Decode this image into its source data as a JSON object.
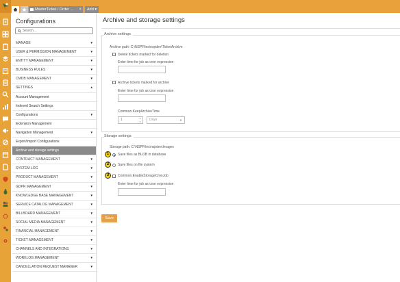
{
  "topbar": {
    "tabs": [
      {
        "label": "MasterTicket / Order ...",
        "close": "×"
      }
    ],
    "add_label": "Add ▾",
    "colors": {
      "bar": "#e9a23b",
      "tab": "#8c8c8c"
    }
  },
  "rail": {
    "icons": [
      "file-icon",
      "grid-icon",
      "clipboard-icon",
      "layers-icon",
      "document-icon",
      "folder-icon",
      "calculator-icon",
      "search-icon",
      "bar-chart-icon",
      "chat-icon",
      "megaphone-icon",
      "ban-icon",
      "calendar-icon",
      "page-icon",
      "shield-icon",
      "bug-icon",
      "people-icon",
      "gear-icon",
      "gears-icon",
      "cog-icon"
    ]
  },
  "config": {
    "title": "Configurations",
    "search_placeholder": "Search...",
    "menu": [
      {
        "label": "MANAGE",
        "arrow": "▼"
      },
      {
        "label": "USER & PERMISSION MANAGEMENT",
        "arrow": "▼"
      },
      {
        "label": "ENTITY MANAGEMENT",
        "arrow": "▼"
      },
      {
        "label": "BUSINESS RULES",
        "arrow": "▼"
      },
      {
        "label": "CMDB MANAGEMENT",
        "arrow": "▼"
      },
      {
        "label": "SETTINGS",
        "arrow": "▲"
      },
      {
        "label": "Account Management",
        "arrow": ""
      },
      {
        "label": "Indexed Search Settings",
        "arrow": ""
      },
      {
        "label": "Configurations",
        "arrow": "▼"
      },
      {
        "label": "Extension Management",
        "arrow": ""
      },
      {
        "label": "Navigation Management",
        "arrow": "▼"
      },
      {
        "label": "Export/Import Configurations",
        "arrow": ""
      },
      {
        "label": "Archive and storage settings",
        "arrow": ""
      },
      {
        "label": "CONTRACT MANAGEMENT",
        "arrow": "▼"
      },
      {
        "label": "SYSTEM LOG",
        "arrow": "▼"
      },
      {
        "label": "PRODUCT MANAGEMENT",
        "arrow": "▼"
      },
      {
        "label": "GDPR MANAGEMENT",
        "arrow": "▼"
      },
      {
        "label": "KNOWLEDGE BASE MANAGEMENT",
        "arrow": "▼"
      },
      {
        "label": "SERVICE CATALOG MANAGEMENT",
        "arrow": "▼"
      },
      {
        "label": "BILLBOARD MANAGEMENT",
        "arrow": "▼"
      },
      {
        "label": "SOCIAL MEDIA MANAGEMENT",
        "arrow": "▼"
      },
      {
        "label": "FINANCIAL MANAGEMENT",
        "arrow": "▼"
      },
      {
        "label": "TICKET MANAGEMENT",
        "arrow": "▼"
      },
      {
        "label": "CHANNELS AND INTEGRATIONS",
        "arrow": "▼"
      },
      {
        "label": "WORKLOG MANAGEMENT",
        "arrow": "▼"
      },
      {
        "label": "CANCELLATION REQUEST MANAGER",
        "arrow": "▼"
      }
    ]
  },
  "page": {
    "title": "Archive and storage settings",
    "archive": {
      "legend": "Archive settings",
      "path_label": "Archive path: C:\\NSPFiles\\nspdev\\TicketArchive",
      "delete_label": "Delete tickets marked for deletion",
      "cron_label_1": "Enter time for job as cron expression",
      "archive_label": "Archive tickets marked for archive",
      "cron_label_2": "Enter time for job as cron expression",
      "keep_label": "Common.KeepArchiveTime",
      "keep_value": "1",
      "keep_unit": "Days"
    },
    "storage": {
      "legend": "Storage settings",
      "path_label": "Storage path: C:\\NSPFiles\\nspdev\\Images",
      "opt_blob": "Save files as BLOB in database",
      "opt_fs": "Save files on file system",
      "opt_cron": "Common.EnableStorageCronJob",
      "cron_label": "Enter time for job as cron expression",
      "badges": [
        "1",
        "2",
        "3"
      ]
    },
    "save_label": "Save"
  }
}
